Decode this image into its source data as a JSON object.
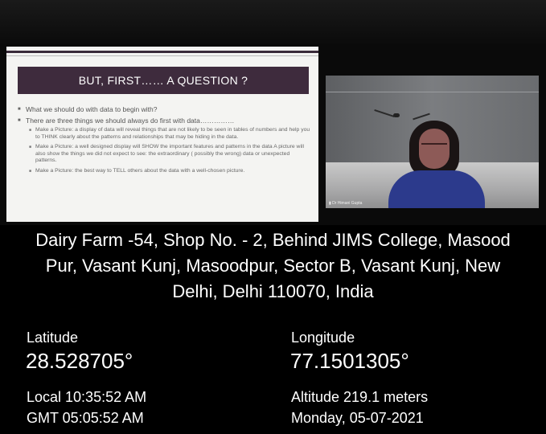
{
  "slide": {
    "title": "BUT, FIRST…… A QUESTION ?",
    "bullets": [
      "What we should do with data to begin with?",
      "There are three things we should always do first with data……………"
    ],
    "subbullets": [
      "Make a Picture: a display of data will reveal things that are not likely to be seen in tables of numbers and help you to THINK clearly about the patterns and relationships that may be hiding in the data.",
      "Make a Picture: a well designed display will SHOW the important features and patterns in the data A picture will also show the things we did not expect to see: the extraordinary ( possibly the wrong) data or unexpected patterns.",
      "Make a Picture: the best way to TELL others about the data with a well-chosen picture."
    ]
  },
  "video": {
    "participant_name": "Dr Himani Gupta"
  },
  "location": {
    "address_line1": "Dairy Farm -54, Shop No. - 2, Behind JIMS College, Masood",
    "address_line2": "Pur, Vasant Kunj, Masoodpur, Sector B, Vasant Kunj, New",
    "address_line3": "Delhi, Delhi 110070, India",
    "latitude_label": "Latitude",
    "latitude_value": "28.528705°",
    "longitude_label": "Longitude",
    "longitude_value": "77.1501305°",
    "local_time": "Local 10:35:52 AM",
    "gmt_time": "GMT 05:05:52 AM",
    "altitude": "Altitude 219.1 meters",
    "date": "Monday, 05-07-2021"
  }
}
